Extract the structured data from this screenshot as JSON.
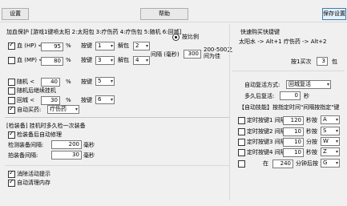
{
  "toolbar": {
    "settings_label": "设置",
    "help_label": "帮助",
    "save_label": "保存设置"
  },
  "protect": {
    "header": "加血保护 [游戏1键喷太阳 2:太阳包 3:疗伤药 4:疗伤包 5:随机 6:回城]",
    "rows": [
      {
        "label": "血 (HP)  <",
        "value": "95",
        "unit": "%",
        "key_label": "按键",
        "key": "1",
        "cd_label": "解包",
        "cd": "2"
      },
      {
        "label": "血 (MP)  <",
        "value": "80",
        "unit": "%",
        "key_label": "按键",
        "key": "3",
        "cd_label": "解包",
        "cd": "4"
      }
    ],
    "ratio_label": "按比例",
    "interval_label": "间隔 (毫秒)",
    "interval_value": "300",
    "interval_hint1": "200-500之",
    "interval_hint2": "间为佳",
    "random_label": "随机  <",
    "random_value": "40",
    "random_unit": "%",
    "random_key_label": "按键",
    "random_key": "5",
    "random_back_label": "随机后继续挂机",
    "city_label": "回城  <",
    "city_value": "30",
    "city_unit": "%",
    "city_key_label": "按键",
    "city_key": "6",
    "auto_med_label": "自动买药:",
    "auto_med_value": "疗伤药"
  },
  "equip": {
    "header": "[检装备] 挂机时多久检一次装备",
    "check_label": "检装备后自动修理",
    "check_time_label": "检测装备间隔:",
    "check_time_value": "200",
    "check_time_unit": "毫秒",
    "repair_time_label": "拍装备间隔:",
    "repair_time_value": "30",
    "repair_time_unit": "毫秒"
  },
  "bottom": {
    "hint_label": "消除活动提示",
    "clean_label": "自动清理内存"
  },
  "shortcut": {
    "title": "快速购买快捷键",
    "desc": "太阳水 -> Alt+1  疗伤药 -> Alt+2",
    "count_label": "按1买次",
    "count_value": "3",
    "count_unit": "包"
  },
  "auto_recover": {
    "mode_label": "自动复活方式:",
    "mode_value": "回城复活",
    "time_label": "多久后复活:",
    "time_value": "0",
    "time_unit": "秒"
  },
  "auto_skill": {
    "header": "【自动技能】按指定时间\"间隔按指定\"键",
    "rows": [
      {
        "label": "定时按键1 间隔:",
        "value": "120",
        "unit": "秒按",
        "key": "A"
      },
      {
        "label": "定时按键2 间隔:",
        "value": "10",
        "unit": "秒按",
        "key": "S"
      },
      {
        "label": "定时按键3 间隔:",
        "value": "10",
        "unit": "分按",
        "key": "W"
      },
      {
        "label": "定时按键4 间隔:",
        "value": "10",
        "unit": "秒按",
        "key": "Z"
      }
    ],
    "last_row": {
      "label": "在",
      "value": "240",
      "unit": "分钟后按",
      "key": "G"
    }
  }
}
